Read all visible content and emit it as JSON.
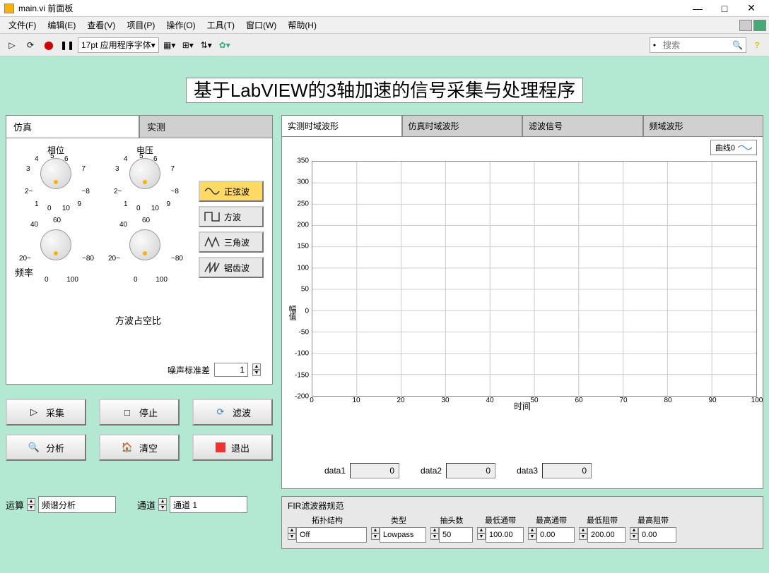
{
  "window": {
    "title": "main.vi 前面板",
    "min": "—",
    "max": "□",
    "close": "✕"
  },
  "menu": [
    "文件(F)",
    "编辑(E)",
    "查看(V)",
    "项目(P)",
    "操作(O)",
    "工具(T)",
    "窗口(W)",
    "帮助(H)"
  ],
  "toolbar": {
    "font": "17pt 应用程序字体",
    "search_placeholder": "搜索"
  },
  "main_title": "基于LabVIEW的3轴加速的信号采集与处理程序",
  "left_tabs": [
    "仿真",
    "实测"
  ],
  "knobs": {
    "phase": {
      "label": "相位",
      "ticks": [
        "0",
        "1",
        "2~",
        "3",
        "4",
        "5",
        "6",
        "7",
        "~8",
        "9",
        "10"
      ]
    },
    "voltage": {
      "label": "电压",
      "ticks": [
        "0",
        "1",
        "2~",
        "3",
        "4",
        "5",
        "6",
        "7",
        "~8",
        "9",
        "10"
      ]
    },
    "freq": {
      "label": "频率",
      "ticks": [
        "0",
        "20~",
        "40",
        "60",
        "~80",
        "100"
      ]
    },
    "duty": {
      "label": "方波占空比",
      "ticks": [
        "0",
        "20~",
        "40",
        "60",
        "~80",
        "100"
      ]
    }
  },
  "waves": [
    {
      "label": "正弦波",
      "active": true
    },
    {
      "label": "方波",
      "active": false
    },
    {
      "label": "三角波",
      "active": false
    },
    {
      "label": "锯齿波",
      "active": false
    }
  ],
  "noise": {
    "label": "噪声标准差",
    "value": "1"
  },
  "actions": {
    "collect": "采集",
    "stop": "停止",
    "filter": "滤波",
    "analyze": "分析",
    "clear": "清空",
    "exit": "退出"
  },
  "bottom": {
    "op_label": "运算",
    "op_value": "频谱分析",
    "ch_label": "通道",
    "ch_value": "通道 1"
  },
  "right_tabs": [
    "实测时域波形",
    "仿真时域波形",
    "滤波信号",
    "频域波形"
  ],
  "chart_data": {
    "type": "line",
    "series": [
      {
        "name": "曲线0",
        "values": []
      }
    ],
    "x": [],
    "xlabel": "时间",
    "ylabel": "幅值",
    "xlim": [
      0,
      100
    ],
    "ylim": [
      -200,
      350
    ],
    "xticks": [
      0,
      10,
      20,
      30,
      40,
      50,
      60,
      70,
      80,
      90,
      100
    ],
    "yticks": [
      -200,
      -150,
      -100,
      -50,
      0,
      50,
      100,
      150,
      200,
      250,
      300,
      350
    ],
    "legend": "曲线0"
  },
  "data_outputs": {
    "d1": {
      "label": "data1",
      "value": "0"
    },
    "d2": {
      "label": "data2",
      "value": "0"
    },
    "d3": {
      "label": "data3",
      "value": "0"
    }
  },
  "fir": {
    "title": "FIR滤波器规范",
    "cols": {
      "topo": {
        "hdr": "拓扑结构",
        "val": "Off"
      },
      "type": {
        "hdr": "类型",
        "val": "Lowpass"
      },
      "taps": {
        "hdr": "抽头数",
        "val": "50"
      },
      "lopass": {
        "hdr": "最低通带",
        "val": "100.00"
      },
      "hipass": {
        "hdr": "最高通带",
        "val": "0.00"
      },
      "lostop": {
        "hdr": "最低阻带",
        "val": "200.00"
      },
      "histop": {
        "hdr": "最高阻带",
        "val": "0.00"
      }
    }
  }
}
